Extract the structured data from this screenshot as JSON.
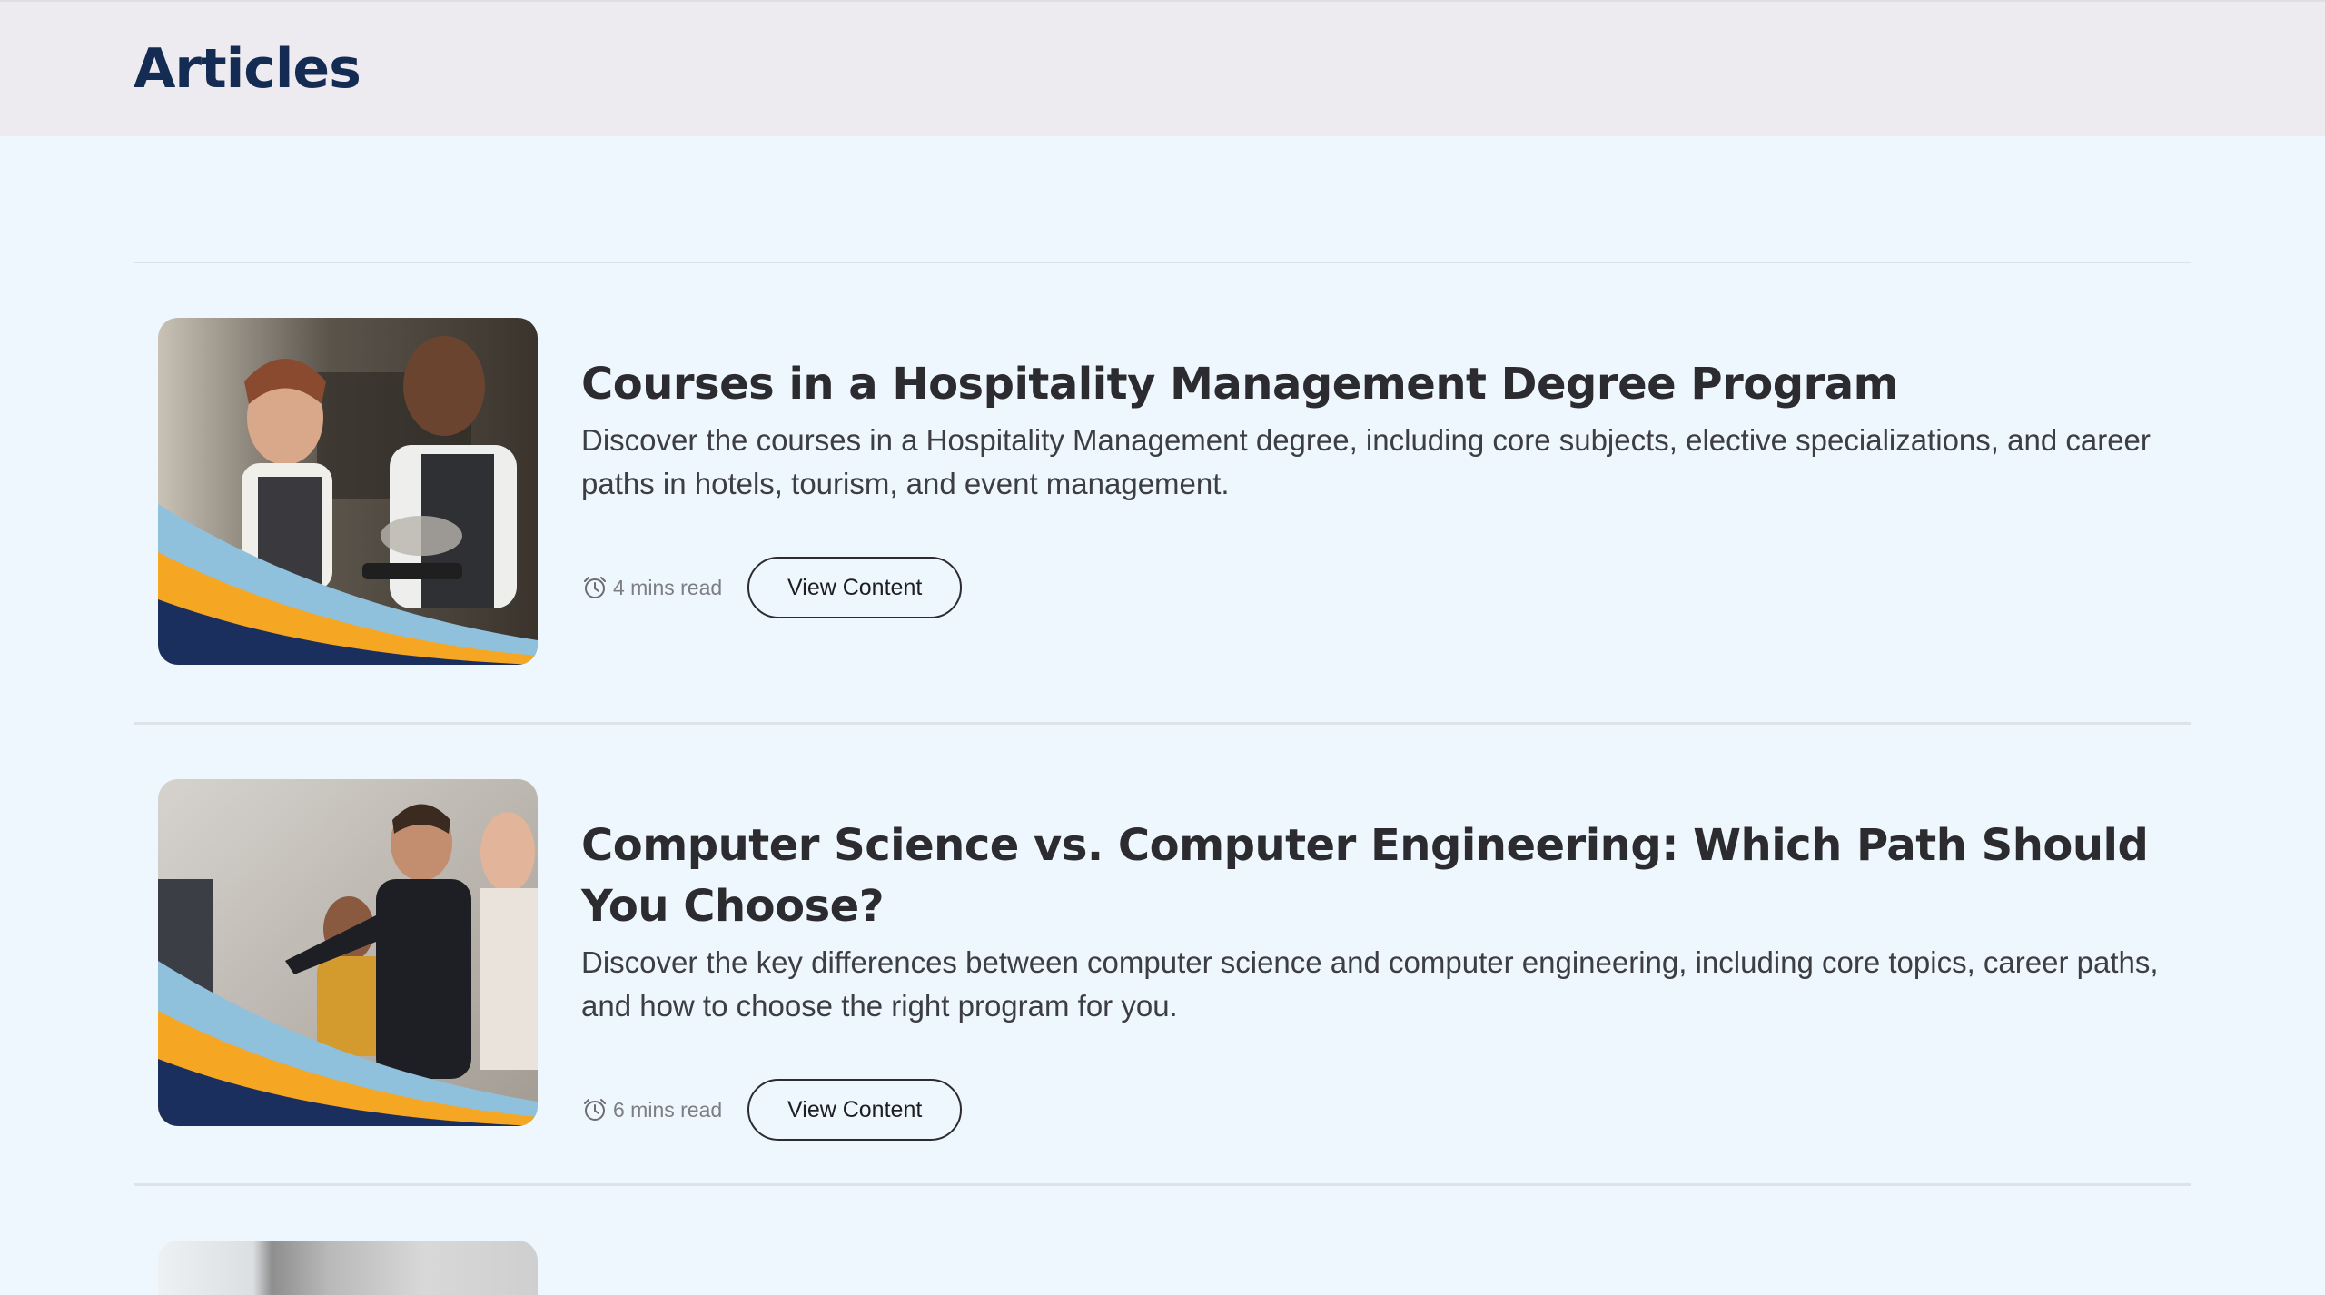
{
  "header": {
    "title": "Articles"
  },
  "articles": [
    {
      "title": "Courses in a Hospitality Management Degree Program",
      "description": "Discover the courses in a Hospitality Management degree, including core subjects, elective specializations, and career paths in hotels, tourism, and event management.",
      "read_time": "4 mins read",
      "button_label": "View Content",
      "image_alt": "hospitality-staff-photo"
    },
    {
      "title": "Computer Science vs. Computer Engineering: Which Path Should You Choose?",
      "description": "Discover the key differences between computer science and computer engineering, including core topics, career paths, and how to choose the right program for you.",
      "read_time": "6 mins read",
      "button_label": "View Content",
      "image_alt": "computer-lab-photo"
    }
  ],
  "colors": {
    "header_bg": "#eeebf0",
    "page_bg": "#eef7fd",
    "title_navy": "#142c54",
    "wave_blue": "#8fc1dc",
    "wave_orange": "#f5a623",
    "wave_navy": "#1b2f5e"
  },
  "icons": {
    "read_time": "alarm-clock-icon"
  }
}
